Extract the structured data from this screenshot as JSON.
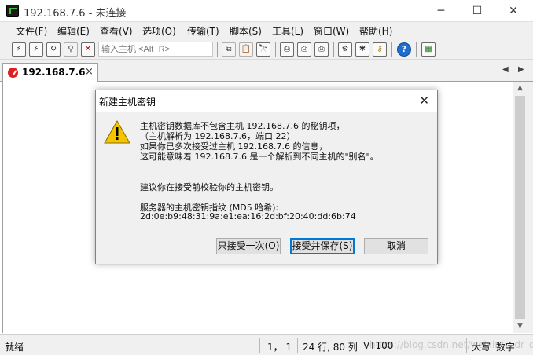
{
  "window": {
    "title": "192.168.7.6 - 未连接",
    "minimize_glyph": "─",
    "maximize_glyph": "☐",
    "close_glyph": "✕"
  },
  "menu": {
    "items": [
      {
        "label": "文件(F)"
      },
      {
        "label": "编辑(E)"
      },
      {
        "label": "查看(V)"
      },
      {
        "label": "选项(O)"
      },
      {
        "label": "传输(T)"
      },
      {
        "label": "脚本(S)"
      },
      {
        "label": "工具(L)"
      },
      {
        "label": "窗口(W)"
      },
      {
        "label": "帮助(H)"
      }
    ]
  },
  "toolbar": {
    "host_input_placeholder": "输入主机 <Alt+R>",
    "icons": [
      "connect-icon",
      "quick-connect-icon",
      "reconnect-icon",
      "disconnect-icon",
      "copy-icon",
      "paste-icon",
      "find-icon",
      "print-setup-icon",
      "print-screen-icon",
      "print-icon",
      "session-options-icon",
      "global-options-icon",
      "key-map-icon",
      "help-icon",
      "sftp-icon"
    ],
    "help_glyph": "?"
  },
  "tabs": {
    "active": {
      "label": "192.168.7.6",
      "close_glyph": "×"
    },
    "scroll_left": "◀",
    "scroll_right": "▶"
  },
  "scrollbar": {
    "up_glyph": "▲",
    "down_glyph": "▼"
  },
  "dialog": {
    "title": "新建主机密钥",
    "close_glyph": "✕",
    "lines": [
      "主机密钥数据库不包含主机 192.168.7.6 的秘钥项，",
      "（主机解析为 192.168.7.6，端口 22）",
      "如果你已多次接受过主机 192.168.7.6 的信息，",
      "这可能意味着 192.168.7.6 是一个解析到不同主机的\"别名\"。",
      "建议你在接受前校验你的主机密钥。",
      "服务器的主机密钥指纹 (MD5 哈希):",
      "2d:0e:b9:48:31:9a:e1:ea:16:2d:bf:20:40:dd:6b:74"
    ],
    "buttons": {
      "accept_once": "只接受一次(O)",
      "accept_save": "接受并保存(S)",
      "cancel": "取消"
    },
    "warning_glyph": "!"
  },
  "status": {
    "ready": "就绪",
    "cursor": "1，   1",
    "size": "24 行, 80 列",
    "terminal_type": "VT100",
    "caps": "大写",
    "num": "数字",
    "watermark": "https://blog.csdn.net/weixin_...dr_de..."
  },
  "colors": {
    "accent": "#0078d7",
    "tab_icon": "#e02020",
    "warning": "#f5c400"
  }
}
